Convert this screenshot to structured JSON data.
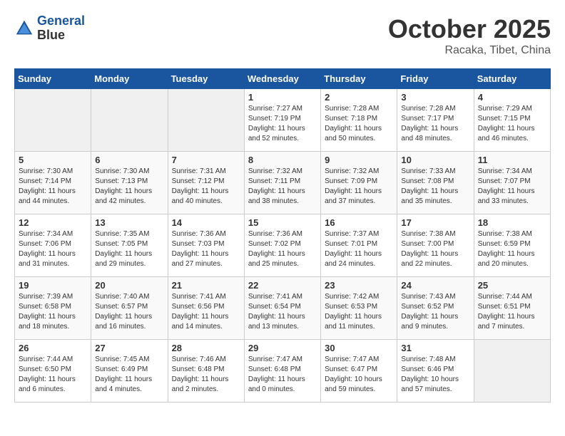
{
  "header": {
    "logo_line1": "General",
    "logo_line2": "Blue",
    "month": "October 2025",
    "location": "Racaka, Tibet, China"
  },
  "weekdays": [
    "Sunday",
    "Monday",
    "Tuesday",
    "Wednesday",
    "Thursday",
    "Friday",
    "Saturday"
  ],
  "weeks": [
    [
      {
        "day": "",
        "sunrise": "",
        "sunset": "",
        "daylight": ""
      },
      {
        "day": "",
        "sunrise": "",
        "sunset": "",
        "daylight": ""
      },
      {
        "day": "",
        "sunrise": "",
        "sunset": "",
        "daylight": ""
      },
      {
        "day": "1",
        "sunrise": "Sunrise: 7:27 AM",
        "sunset": "Sunset: 7:19 PM",
        "daylight": "Daylight: 11 hours and 52 minutes."
      },
      {
        "day": "2",
        "sunrise": "Sunrise: 7:28 AM",
        "sunset": "Sunset: 7:18 PM",
        "daylight": "Daylight: 11 hours and 50 minutes."
      },
      {
        "day": "3",
        "sunrise": "Sunrise: 7:28 AM",
        "sunset": "Sunset: 7:17 PM",
        "daylight": "Daylight: 11 hours and 48 minutes."
      },
      {
        "day": "4",
        "sunrise": "Sunrise: 7:29 AM",
        "sunset": "Sunset: 7:15 PM",
        "daylight": "Daylight: 11 hours and 46 minutes."
      }
    ],
    [
      {
        "day": "5",
        "sunrise": "Sunrise: 7:30 AM",
        "sunset": "Sunset: 7:14 PM",
        "daylight": "Daylight: 11 hours and 44 minutes."
      },
      {
        "day": "6",
        "sunrise": "Sunrise: 7:30 AM",
        "sunset": "Sunset: 7:13 PM",
        "daylight": "Daylight: 11 hours and 42 minutes."
      },
      {
        "day": "7",
        "sunrise": "Sunrise: 7:31 AM",
        "sunset": "Sunset: 7:12 PM",
        "daylight": "Daylight: 11 hours and 40 minutes."
      },
      {
        "day": "8",
        "sunrise": "Sunrise: 7:32 AM",
        "sunset": "Sunset: 7:11 PM",
        "daylight": "Daylight: 11 hours and 38 minutes."
      },
      {
        "day": "9",
        "sunrise": "Sunrise: 7:32 AM",
        "sunset": "Sunset: 7:09 PM",
        "daylight": "Daylight: 11 hours and 37 minutes."
      },
      {
        "day": "10",
        "sunrise": "Sunrise: 7:33 AM",
        "sunset": "Sunset: 7:08 PM",
        "daylight": "Daylight: 11 hours and 35 minutes."
      },
      {
        "day": "11",
        "sunrise": "Sunrise: 7:34 AM",
        "sunset": "Sunset: 7:07 PM",
        "daylight": "Daylight: 11 hours and 33 minutes."
      }
    ],
    [
      {
        "day": "12",
        "sunrise": "Sunrise: 7:34 AM",
        "sunset": "Sunset: 7:06 PM",
        "daylight": "Daylight: 11 hours and 31 minutes."
      },
      {
        "day": "13",
        "sunrise": "Sunrise: 7:35 AM",
        "sunset": "Sunset: 7:05 PM",
        "daylight": "Daylight: 11 hours and 29 minutes."
      },
      {
        "day": "14",
        "sunrise": "Sunrise: 7:36 AM",
        "sunset": "Sunset: 7:03 PM",
        "daylight": "Daylight: 11 hours and 27 minutes."
      },
      {
        "day": "15",
        "sunrise": "Sunrise: 7:36 AM",
        "sunset": "Sunset: 7:02 PM",
        "daylight": "Daylight: 11 hours and 25 minutes."
      },
      {
        "day": "16",
        "sunrise": "Sunrise: 7:37 AM",
        "sunset": "Sunset: 7:01 PM",
        "daylight": "Daylight: 11 hours and 24 minutes."
      },
      {
        "day": "17",
        "sunrise": "Sunrise: 7:38 AM",
        "sunset": "Sunset: 7:00 PM",
        "daylight": "Daylight: 11 hours and 22 minutes."
      },
      {
        "day": "18",
        "sunrise": "Sunrise: 7:38 AM",
        "sunset": "Sunset: 6:59 PM",
        "daylight": "Daylight: 11 hours and 20 minutes."
      }
    ],
    [
      {
        "day": "19",
        "sunrise": "Sunrise: 7:39 AM",
        "sunset": "Sunset: 6:58 PM",
        "daylight": "Daylight: 11 hours and 18 minutes."
      },
      {
        "day": "20",
        "sunrise": "Sunrise: 7:40 AM",
        "sunset": "Sunset: 6:57 PM",
        "daylight": "Daylight: 11 hours and 16 minutes."
      },
      {
        "day": "21",
        "sunrise": "Sunrise: 7:41 AM",
        "sunset": "Sunset: 6:56 PM",
        "daylight": "Daylight: 11 hours and 14 minutes."
      },
      {
        "day": "22",
        "sunrise": "Sunrise: 7:41 AM",
        "sunset": "Sunset: 6:54 PM",
        "daylight": "Daylight: 11 hours and 13 minutes."
      },
      {
        "day": "23",
        "sunrise": "Sunrise: 7:42 AM",
        "sunset": "Sunset: 6:53 PM",
        "daylight": "Daylight: 11 hours and 11 minutes."
      },
      {
        "day": "24",
        "sunrise": "Sunrise: 7:43 AM",
        "sunset": "Sunset: 6:52 PM",
        "daylight": "Daylight: 11 hours and 9 minutes."
      },
      {
        "day": "25",
        "sunrise": "Sunrise: 7:44 AM",
        "sunset": "Sunset: 6:51 PM",
        "daylight": "Daylight: 11 hours and 7 minutes."
      }
    ],
    [
      {
        "day": "26",
        "sunrise": "Sunrise: 7:44 AM",
        "sunset": "Sunset: 6:50 PM",
        "daylight": "Daylight: 11 hours and 6 minutes."
      },
      {
        "day": "27",
        "sunrise": "Sunrise: 7:45 AM",
        "sunset": "Sunset: 6:49 PM",
        "daylight": "Daylight: 11 hours and 4 minutes."
      },
      {
        "day": "28",
        "sunrise": "Sunrise: 7:46 AM",
        "sunset": "Sunset: 6:48 PM",
        "daylight": "Daylight: 11 hours and 2 minutes."
      },
      {
        "day": "29",
        "sunrise": "Sunrise: 7:47 AM",
        "sunset": "Sunset: 6:48 PM",
        "daylight": "Daylight: 11 hours and 0 minutes."
      },
      {
        "day": "30",
        "sunrise": "Sunrise: 7:47 AM",
        "sunset": "Sunset: 6:47 PM",
        "daylight": "Daylight: 10 hours and 59 minutes."
      },
      {
        "day": "31",
        "sunrise": "Sunrise: 7:48 AM",
        "sunset": "Sunset: 6:46 PM",
        "daylight": "Daylight: 10 hours and 57 minutes."
      },
      {
        "day": "",
        "sunrise": "",
        "sunset": "",
        "daylight": ""
      }
    ]
  ]
}
